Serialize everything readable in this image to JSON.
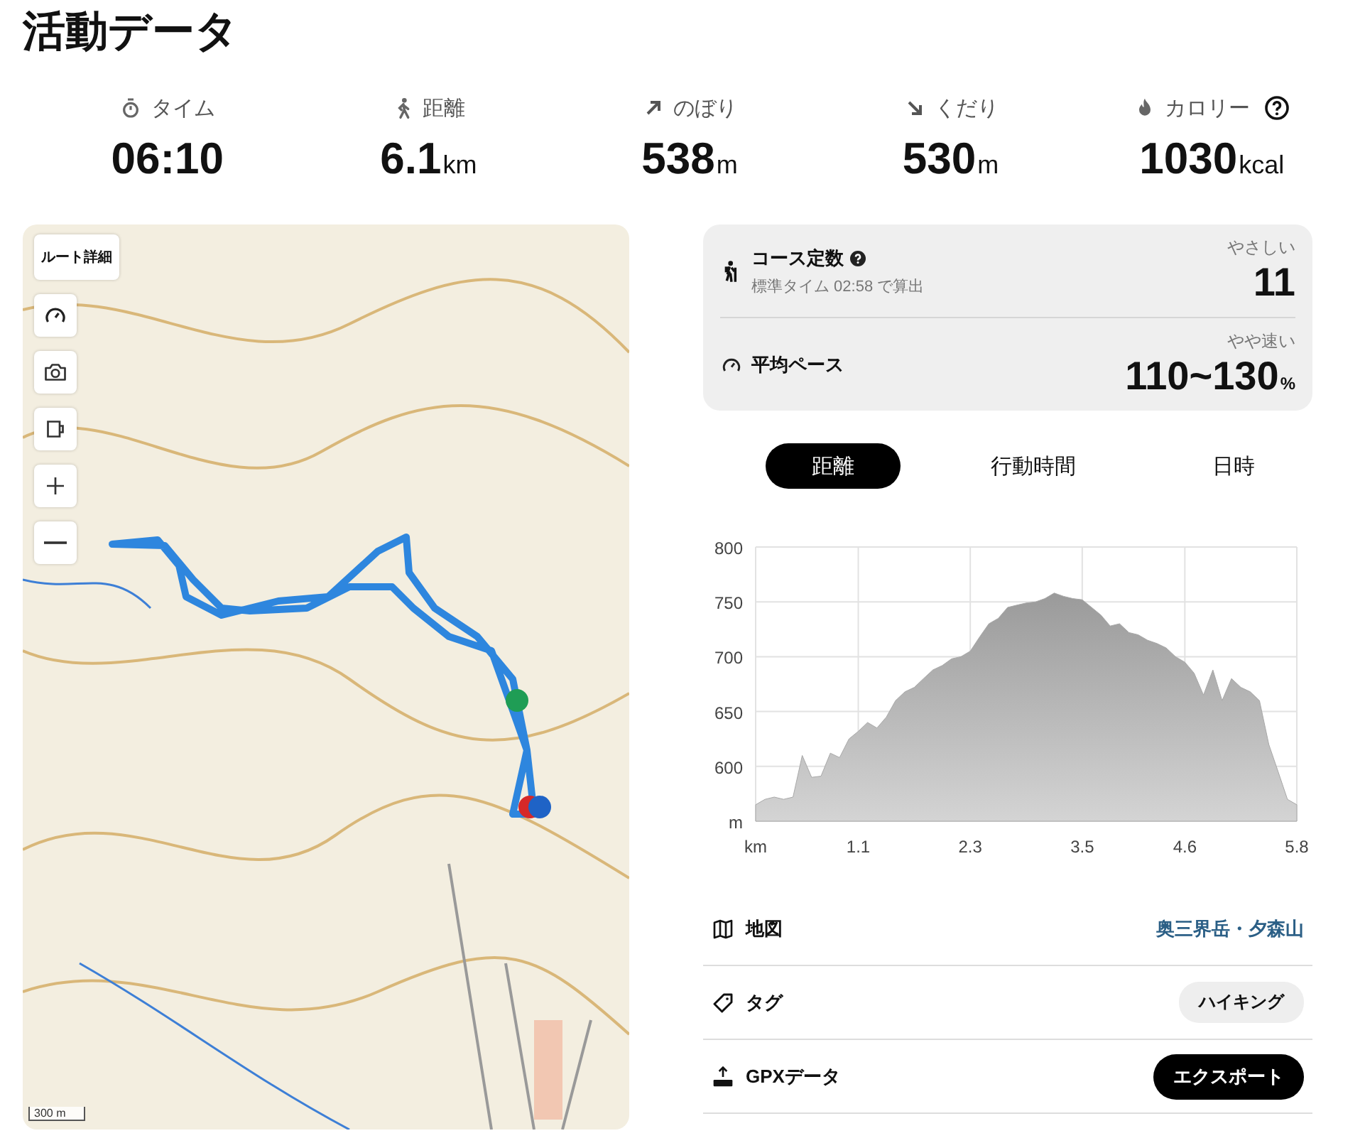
{
  "title": "活動データ",
  "stats": [
    {
      "kind": "time",
      "label": "タイム",
      "value": "06:10"
    },
    {
      "kind": "distance",
      "label": "距離",
      "value": "6.1",
      "unit": "km"
    },
    {
      "kind": "up",
      "label": "のぼり",
      "value": "538",
      "unit": "m"
    },
    {
      "kind": "down",
      "label": "くだり",
      "value": "530",
      "unit": "m"
    },
    {
      "kind": "calorie",
      "label": "カロリー",
      "value": "1030",
      "unit": "kcal",
      "help": true
    }
  ],
  "map": {
    "route_button": "ルート詳細",
    "controls": [
      {
        "kind": "pace"
      },
      {
        "kind": "camera"
      },
      {
        "kind": "cup"
      },
      {
        "kind": "zoom-in"
      },
      {
        "kind": "zoom-out"
      }
    ],
    "scale": "300 m"
  },
  "course": {
    "label": "コース定数",
    "help": true,
    "note": "標準タイム 02:58 で算出",
    "rating": "やさしい",
    "value": "11"
  },
  "pace": {
    "label": "平均ペース",
    "rating": "やや速い",
    "value": "110~130",
    "unit": "%"
  },
  "tabs": [
    {
      "label": "距離",
      "selected": true
    },
    {
      "label": "行動時間",
      "selected": false
    },
    {
      "label": "日時",
      "selected": false
    }
  ],
  "chart_data": {
    "type": "area",
    "x": [
      0,
      0.1,
      0.2,
      0.3,
      0.4,
      0.5,
      0.6,
      0.7,
      0.8,
      0.9,
      1.0,
      1.1,
      1.2,
      1.3,
      1.4,
      1.5,
      1.6,
      1.7,
      1.8,
      1.9,
      2.0,
      2.1,
      2.2,
      2.3,
      2.4,
      2.5,
      2.6,
      2.7,
      2.8,
      2.9,
      3.0,
      3.1,
      3.2,
      3.3,
      3.4,
      3.5,
      3.6,
      3.7,
      3.8,
      3.9,
      4.0,
      4.1,
      4.2,
      4.3,
      4.4,
      4.5,
      4.6,
      4.7,
      4.8,
      4.9,
      5.0,
      5.1,
      5.2,
      5.3,
      5.4,
      5.5,
      5.6,
      5.7,
      5.8
    ],
    "series": [
      {
        "color": "#a8a8a8",
        "values": [
          565,
          570,
          572,
          570,
          572,
          610,
          590,
          591,
          612,
          608,
          625,
          632,
          640,
          635,
          645,
          660,
          668,
          672,
          680,
          688,
          692,
          698,
          700,
          705,
          718,
          730,
          735,
          745,
          747,
          749,
          750,
          753,
          758,
          755,
          753,
          752,
          745,
          738,
          728,
          730,
          722,
          720,
          715,
          712,
          708,
          700,
          695,
          685,
          665,
          688,
          660,
          680,
          672,
          668,
          660,
          620,
          595,
          570,
          565
        ]
      }
    ],
    "grid": true,
    "xlim": [
      0,
      5.8
    ],
    "ylim": [
      550,
      800
    ],
    "xticks": [
      {
        "value": 0,
        "label": "km"
      },
      1.1,
      2.3,
      3.5,
      4.6,
      5.8
    ],
    "yticks": [
      {
        "value": 550,
        "label": "m"
      },
      600,
      650,
      700,
      750,
      800
    ]
  },
  "details": [
    {
      "kind": "map",
      "label": "地図",
      "value": "奥三界岳・夕森山"
    },
    {
      "kind": "tag",
      "label": "タグ",
      "value": "ハイキング"
    },
    {
      "kind": "gpx",
      "label": "GPXデータ",
      "value": "エクスポート"
    }
  ]
}
